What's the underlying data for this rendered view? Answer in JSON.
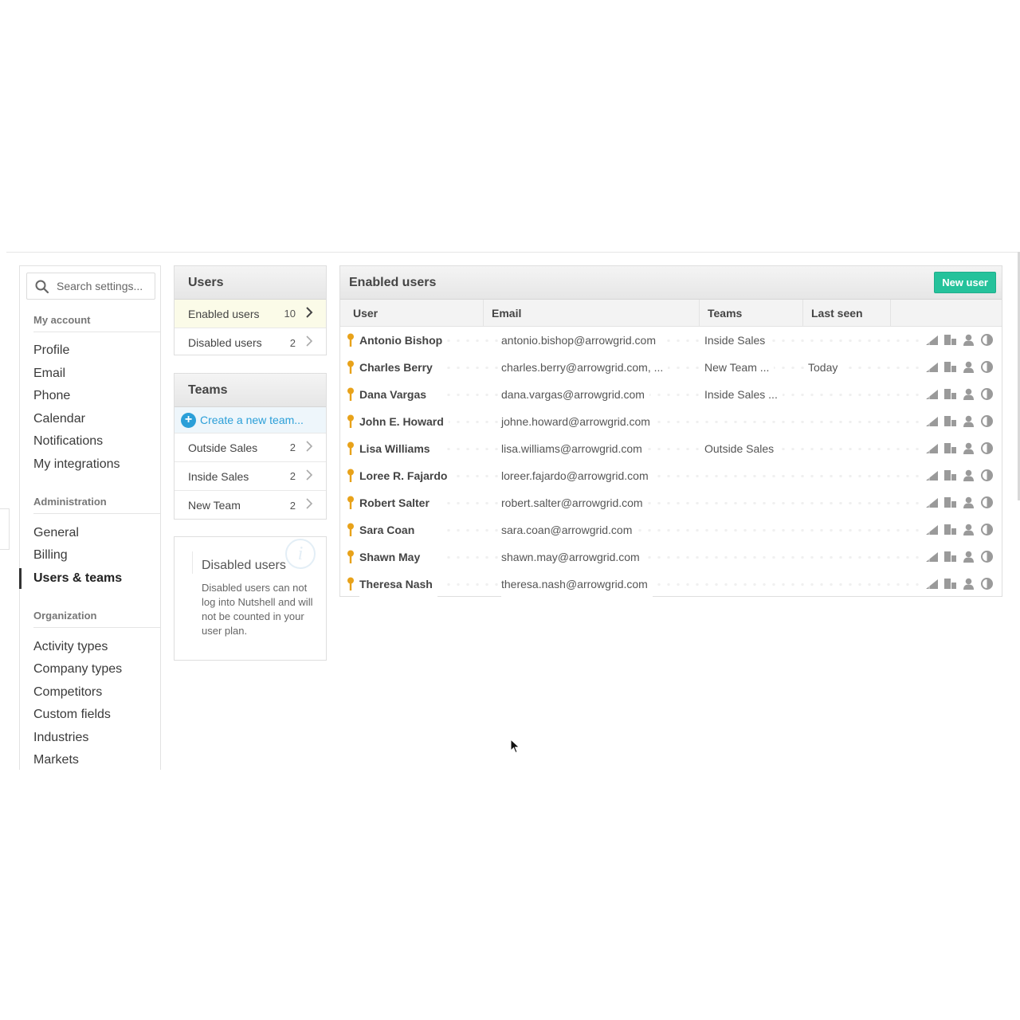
{
  "sidebar": {
    "search_placeholder": "Search settings...",
    "sections": {
      "my_account": "My account",
      "administration": "Administration",
      "organization": "Organization"
    },
    "my_account_items": [
      "Profile",
      "Email",
      "Phone",
      "Calendar",
      "Notifications",
      "My integrations"
    ],
    "administration_items": [
      "General",
      "Billing",
      "Users & teams"
    ],
    "organization_items": [
      "Activity types",
      "Company types",
      "Competitors",
      "Custom fields",
      "Industries",
      "Markets"
    ],
    "active_item": "Users & teams"
  },
  "users_panel": {
    "title": "Users",
    "rows": [
      {
        "label": "Enabled users",
        "count": "10"
      },
      {
        "label": "Disabled users",
        "count": "2"
      }
    ]
  },
  "teams_panel": {
    "title": "Teams",
    "create_label": "Create a new team...",
    "rows": [
      {
        "label": "Outside Sales",
        "count": "2"
      },
      {
        "label": "Inside Sales",
        "count": "2"
      },
      {
        "label": "New Team",
        "count": "2"
      }
    ]
  },
  "info_panel": {
    "title": "Disabled users",
    "text": "Disabled users can not log into Nutshell and will not be counted in your user plan."
  },
  "main": {
    "title": "Enabled users",
    "new_user_label": "New user",
    "columns": [
      "User",
      "Email",
      "Teams",
      "Last seen"
    ],
    "users": [
      {
        "name": "Antonio Bishop",
        "email": "antonio.bishop@arrowgrid.com",
        "teams": "Inside Sales",
        "last_seen": ""
      },
      {
        "name": "Charles Berry",
        "email": "charles.berry@arrowgrid.com, ...",
        "teams": "New Team ...",
        "last_seen": "Today"
      },
      {
        "name": "Dana Vargas",
        "email": "dana.vargas@arrowgrid.com",
        "teams": "Inside Sales ...",
        "last_seen": ""
      },
      {
        "name": "John E. Howard",
        "email": "johne.howard@arrowgrid.com",
        "teams": "",
        "last_seen": ""
      },
      {
        "name": "Lisa Williams",
        "email": "lisa.williams@arrowgrid.com",
        "teams": "Outside Sales",
        "last_seen": ""
      },
      {
        "name": "Loree R. Fajardo",
        "email": "loreer.fajardo@arrowgrid.com",
        "teams": "",
        "last_seen": ""
      },
      {
        "name": "Robert Salter",
        "email": "robert.salter@arrowgrid.com",
        "teams": "",
        "last_seen": ""
      },
      {
        "name": "Sara Coan",
        "email": "sara.coan@arrowgrid.com",
        "teams": "",
        "last_seen": ""
      },
      {
        "name": "Shawn May",
        "email": "shawn.may@arrowgrid.com",
        "teams": "",
        "last_seen": ""
      },
      {
        "name": "Theresa Nash",
        "email": "theresa.nash@arrowgrid.com",
        "teams": "",
        "last_seen": ""
      }
    ],
    "row_icon_names": [
      "chart-icon",
      "building-icon",
      "person-icon",
      "pie-icon"
    ]
  },
  "colors": {
    "accent_green": "#25c29b",
    "link_blue": "#2b9fd8",
    "key_orange": "#e8a21a",
    "selected_row": "#fbfbe8"
  }
}
